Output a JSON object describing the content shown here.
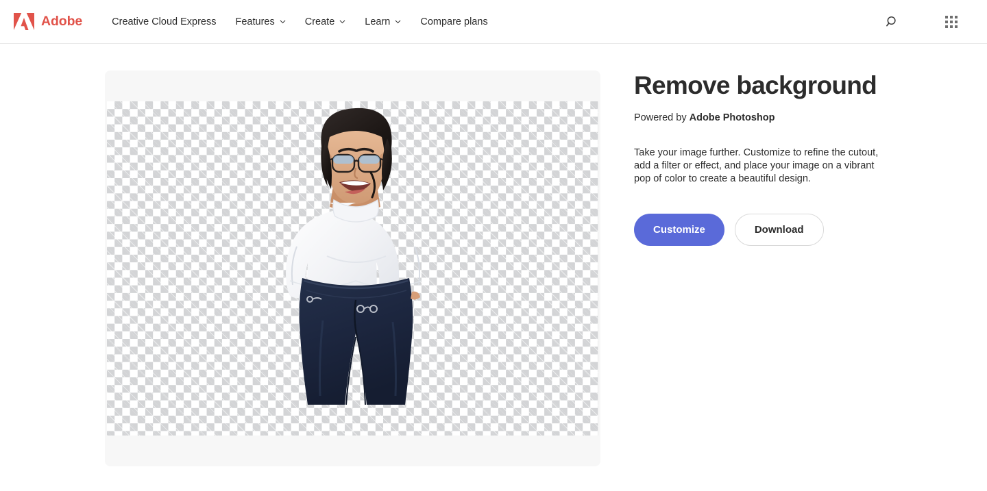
{
  "header": {
    "brand": {
      "name": "Adobe",
      "logo_icon": "adobe-a-logo",
      "color": "#e1534a"
    },
    "nav_items": [
      {
        "label": "Creative Cloud Express",
        "has_caret": false
      },
      {
        "label": "Features",
        "has_caret": true
      },
      {
        "label": "Create",
        "has_caret": true
      },
      {
        "label": "Learn",
        "has_caret": true
      },
      {
        "label": "Compare plans",
        "has_caret": false
      }
    ],
    "actions": [
      {
        "name": "search-icon",
        "label": "Search"
      },
      {
        "name": "apps-grid-icon",
        "label": "Apps"
      }
    ]
  },
  "main": {
    "preview": {
      "name": "image-preview-canvas",
      "background_style": "transparency-checkerboard",
      "checker_colors": [
        "#ffffff",
        "#d3d4d6"
      ],
      "panel_color": "#f7f7f7",
      "subject_alt": "Smiling woman with short dark hair and glasses wearing a white turtleneck sweater and dark blue jeans, hands on hips, background removed"
    },
    "info": {
      "title": "Remove background",
      "powered_by_prefix": "Powered by ",
      "powered_by_product": "Adobe Photoshop",
      "description": "Take your image further. Customize to refine the cutout, add a filter or effect, and place your image on a vibrant pop of color to create a beautiful design.",
      "primary_button": "Customize",
      "secondary_button": "Download",
      "primary_button_color": "#5a6ad9"
    }
  }
}
